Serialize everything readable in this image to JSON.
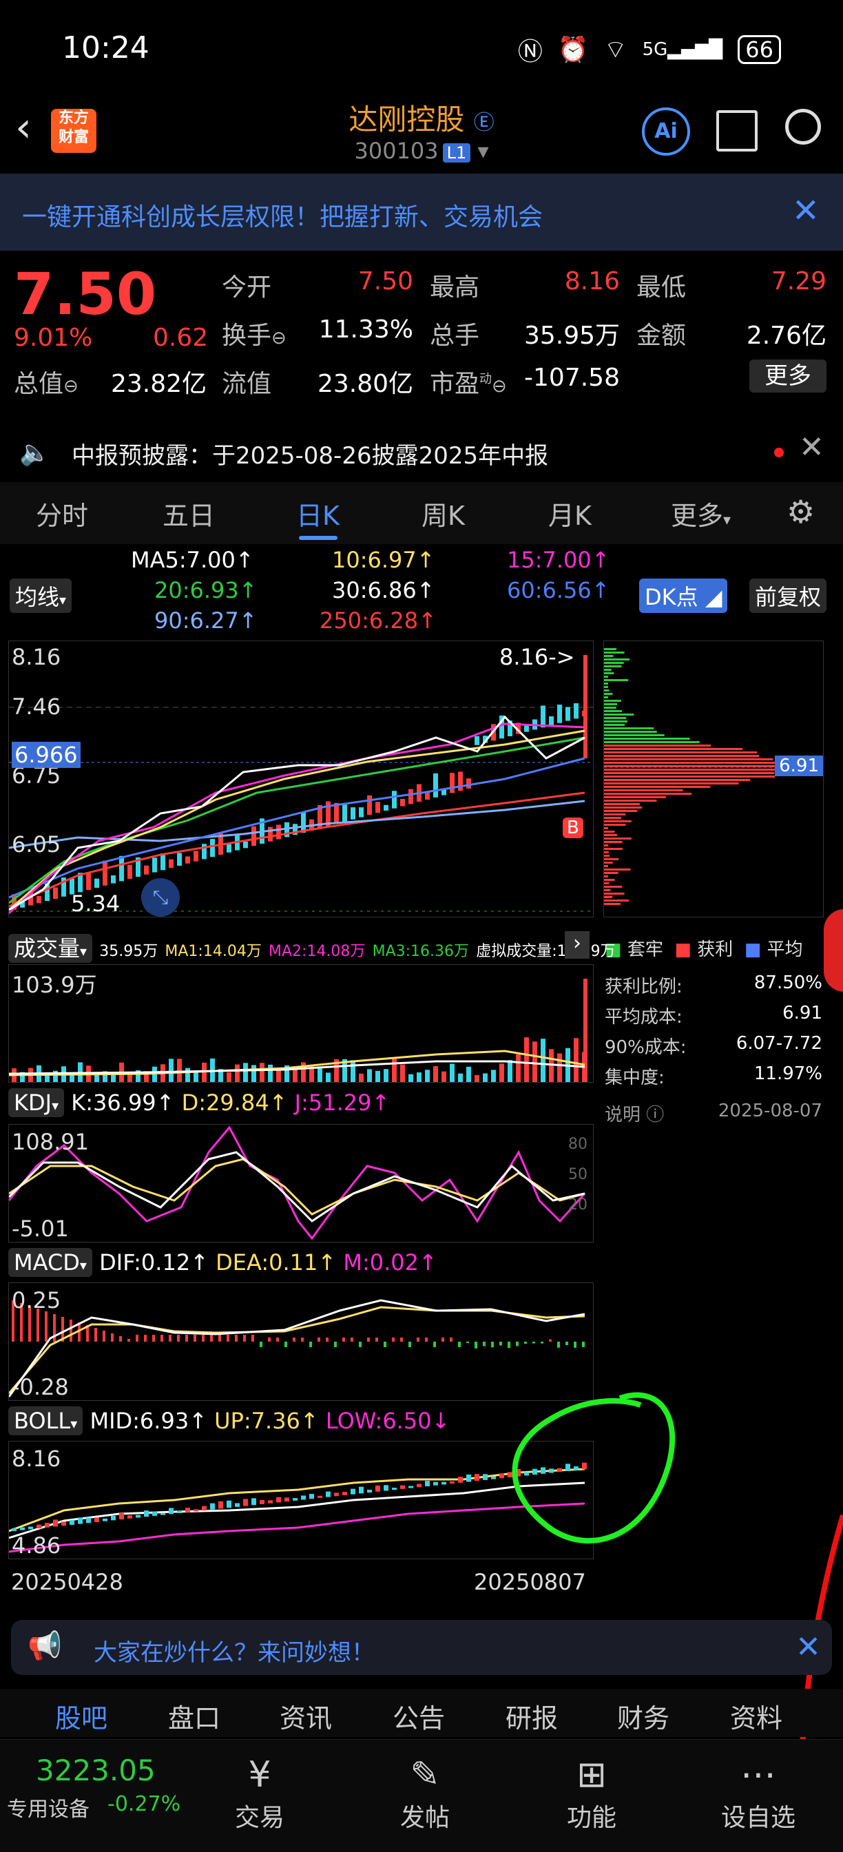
{
  "status": {
    "time": "10:24",
    "battery": "66",
    "network": "5G"
  },
  "header": {
    "name": "达刚控股",
    "code": "300103",
    "level": "L1",
    "logo": "东方\n财富",
    "ai_label": "Ai"
  },
  "banner": {
    "text": "一键开通科创成长层权限！把握打新、交易机会"
  },
  "quote": {
    "price": "7.50",
    "pct": "9.01%",
    "chg": "0.62",
    "open_lbl": "今开",
    "open": "7.50",
    "high_lbl": "最高",
    "high": "8.16",
    "low_lbl": "最低",
    "low": "7.29",
    "turnover_lbl": "换手",
    "turnover": "11.33%",
    "volume_lbl": "总手",
    "volume": "35.95万",
    "amount_lbl": "金额",
    "amount": "2.76亿",
    "mcap_lbl": "总值",
    "mcap": "23.82亿",
    "float_lbl": "流值",
    "float": "23.80亿",
    "pe_lbl": "市盈",
    "pe": "-107.58",
    "more": "更多"
  },
  "notice": {
    "text": "中报预披露：于2025-08-26披露2025年中报"
  },
  "tabs": [
    "分时",
    "五日",
    "日K",
    "周K",
    "月K",
    "更多"
  ],
  "ma": {
    "type": "均线",
    "ma5": "MA5:7.00↑",
    "ma10": "10:6.97↑",
    "ma15": "15:7.00↑",
    "ma20": "20:6.93↑",
    "ma30": "30:6.86↑",
    "ma60": "60:6.56↑",
    "ma90": "90:6.27↑",
    "ma250": "250:6.28↑",
    "dk": "DK点",
    "adj": "前复权"
  },
  "kline": {
    "y_ticks": [
      "8.16",
      "7.46",
      "6.75",
      "6.05",
      "5.34"
    ],
    "current": "6.966",
    "high_mark": "8.16->",
    "low_mark": "5.34",
    "b_mark": "B",
    "chip_level": "6.91"
  },
  "volume": {
    "title": "成交量",
    "vol": "35.95万",
    "ma1": "MA1:14.04万",
    "ma2": "MA2:14.08万",
    "ma3": "MA3:16.36万",
    "virtual": "虚拟成交量:103.9万",
    "max": "103.9万"
  },
  "kdj": {
    "title": "KDJ",
    "k": "K:36.99↑",
    "d": "D:29.84↑",
    "j": "J:51.29↑",
    "max": "108.91",
    "min": "-5.01",
    "l80": "80",
    "l50": "50",
    "l20": "20"
  },
  "macd": {
    "title": "MACD",
    "dif": "DIF:0.12↑",
    "dea": "DEA:0.11↑",
    "m": "M:0.02↑",
    "max": "0.25",
    "min": "-0.28"
  },
  "boll": {
    "title": "BOLL",
    "mid": "MID:6.93↑",
    "up": "UP:7.36↑",
    "low": "LOW:6.50↓",
    "max": "8.16",
    "min": "4.86"
  },
  "dates": {
    "start": "20250428",
    "end": "20250807"
  },
  "chips": {
    "legend_trap": "套牢",
    "legend_profit": "获利",
    "legend_avg": "平均",
    "profit_ratio_lbl": "获利比例:",
    "profit_ratio": "87.50%",
    "avg_cost_lbl": "平均成本:",
    "avg_cost": "6.91",
    "cost90_lbl": "90%成本:",
    "cost90": "6.07-7.72",
    "concentration_lbl": "集中度:",
    "concentration": "11.97%",
    "desc_lbl": "说明",
    "date": "2025-08-07"
  },
  "ask": {
    "text": "大家在炒什么？来问妙想！"
  },
  "bottom_tabs": [
    "股吧",
    "盘口",
    "资讯",
    "公告",
    "研报",
    "财务",
    "资料"
  ],
  "index": {
    "value": "3223.05",
    "name": "专用设备",
    "change": "-0.27%"
  },
  "bottom_buttons": [
    "交易",
    "发帖",
    "功能",
    "设自选"
  ]
}
